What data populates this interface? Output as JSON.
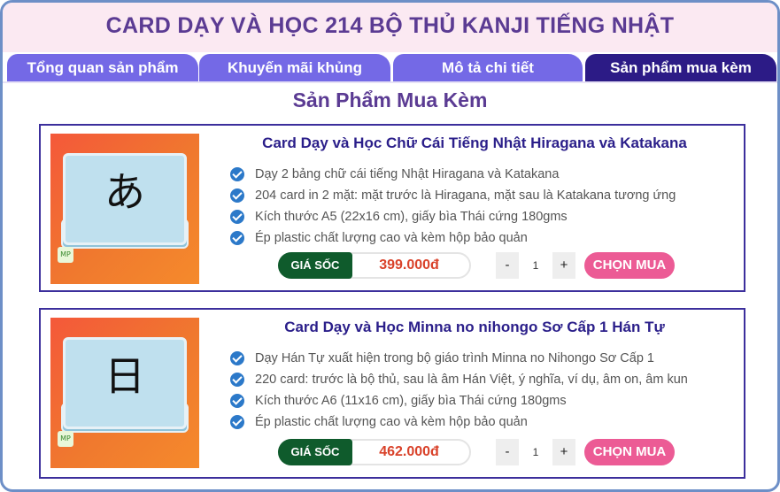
{
  "page_title": "CARD DẠY VÀ HỌC 214 BỘ THỦ KANJI TIẾNG NHẬT",
  "tabs": [
    {
      "label": "Tổng quan sản phẩm"
    },
    {
      "label": "Khuyến mãi khủng"
    },
    {
      "label": "Mô tả chi tiết"
    },
    {
      "label": "Sản phẩm mua kèm"
    }
  ],
  "section_title": "Sản Phẩm Mua Kèm",
  "products": [
    {
      "name": "Card Dạy và Học Chữ Cái Tiếng Nhật Hiragana và Katakana",
      "thumb_glyph": "あ",
      "features": [
        "Dạy 2 bảng chữ cái tiếng Nhật Hiragana và Katakana",
        "204 card in 2 mặt: mặt trước là Hiragana, mặt sau là Katakana tương ứng",
        "Kích thước A5 (22x16 cm), giấy bìa Thái cứng 180gms",
        "Ép plastic chất lượng cao và kèm hộp bảo quản"
      ],
      "price_label": "GIÁ SỐC",
      "price": "399.000đ",
      "quantity": "1",
      "minus": "-",
      "plus": "+",
      "buy_label": "CHỌN MUA"
    },
    {
      "name": "Card Dạy và Học Minna no nihongo Sơ Cấp 1 Hán Tự",
      "thumb_glyph": "日",
      "features": [
        "Dạy Hán Tự xuất hiện trong bộ giáo trình Minna no Nihongo Sơ Cấp 1",
        "220 card: trước là bộ thủ, sau là âm Hán Việt, ý nghĩa, ví dụ, âm on, âm kun",
        "Kích thước A6 (11x16 cm), giấy bìa Thái cứng 180gms",
        "Ép plastic chất lượng cao và kèm hộp bảo quản"
      ],
      "price_label": "GIÁ SỐC",
      "price": "462.000đ",
      "quantity": "1",
      "minus": "-",
      "plus": "+",
      "buy_label": "CHỌN MUA"
    }
  ],
  "colors": {
    "title": "#5b3b93",
    "tab": "#7469e6",
    "tab_active": "#2c1b86",
    "price_label_bg": "#0f5b2c",
    "price": "#d9422a",
    "buy_button": "#ec5b95",
    "check": "#2c79c9"
  }
}
